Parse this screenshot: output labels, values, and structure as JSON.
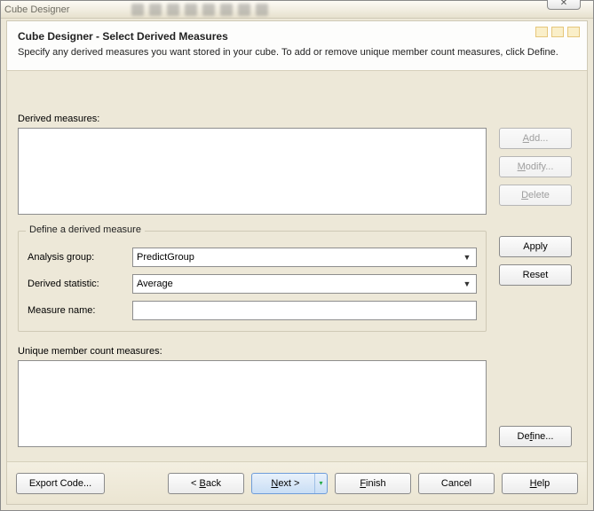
{
  "window": {
    "title": "Cube Designer",
    "close_glyph": "✕"
  },
  "header": {
    "title": "Cube Designer - Select Derived Measures",
    "description": "Specify any derived measures you want stored in your cube. To add or remove unique member count measures, click Define."
  },
  "sections": {
    "derived_measures_label": "Derived measures:",
    "define_legend": "Define a derived measure",
    "analysis_group_label": "Analysis group:",
    "derived_statistic_label": "Derived statistic:",
    "measure_name_label": "Measure name:",
    "unique_label": "Unique member count measures:"
  },
  "values": {
    "analysis_group": "PredictGroup",
    "derived_statistic": "Average",
    "measure_name": ""
  },
  "buttons": {
    "add": "Add...",
    "modify": "Modify...",
    "delete": "Delete",
    "apply": "Apply",
    "reset": "Reset",
    "define": "Define..."
  },
  "footer": {
    "export": "Export Code...",
    "back": "< Back",
    "next": "Next >",
    "finish": "Finish",
    "cancel": "Cancel",
    "help": "Help"
  }
}
